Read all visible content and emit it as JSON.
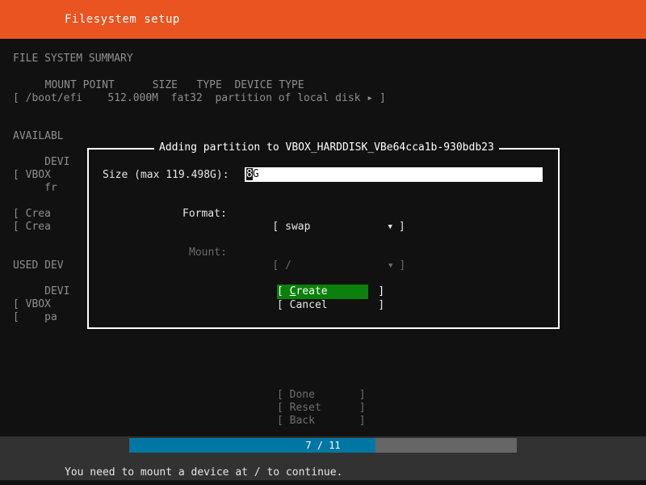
{
  "header": {
    "title": "Filesystem setup",
    "bg_color": "#e95420"
  },
  "colors": {
    "background": "#111111",
    "accent_orange": "#e95420",
    "highlight_green": "#0c800c",
    "progress_blue": "#0077a3",
    "progress_track": "#666666",
    "footer_bg": "#323232"
  },
  "summary": {
    "section_title": "FILE SYSTEM SUMMARY",
    "columns": "  MOUNT POINT      SIZE   TYPE  DEVICE TYPE",
    "row": "[ /boot/efi    512.000M  fat32  partition of local disk ▸ ]"
  },
  "available_section": {
    "section_title": "AVAILABL",
    "lines": [
      "     DEVI",
      "[ VBOX",
      "     fr",
      "[ Crea",
      "[ Crea"
    ]
  },
  "used_section": {
    "section_title": "USED DEV",
    "lines": [
      "     DEVI",
      "[ VBOX",
      "[    pa"
    ]
  },
  "dialog": {
    "title": "Adding partition to VBOX_HARDDISK_VBe64cca1b-930bdb23",
    "size_label": "Size (max 119.498G):",
    "size_value": "8G",
    "size_cursor_char": "8",
    "size_rest": "G",
    "format_label": "Format:",
    "format_value": "swap",
    "format_open_bracket": "[",
    "format_close_bracket": "]",
    "format_arrow": "▼",
    "mount_label": "Mount:",
    "mount_value": "/",
    "mount_open_bracket": "[",
    "mount_close_bracket": "]",
    "mount_arrow": "▼",
    "mount_disabled": true,
    "create_button": "[ Create        ]",
    "create_accel": "C",
    "create_prefix": "[ ",
    "create_suffix": "reate        ]",
    "cancel_button": "[ Cancel        ]"
  },
  "nav_buttons": [
    {
      "label": "[ Done       ]"
    },
    {
      "label": "[ Reset      ]"
    },
    {
      "label": "[ Back       ]"
    }
  ],
  "footer": {
    "progress_label": "7 / 11",
    "progress_current": 7,
    "progress_total": 11,
    "progress_percent": 63,
    "status_message": "You need to mount a device at / to continue."
  }
}
